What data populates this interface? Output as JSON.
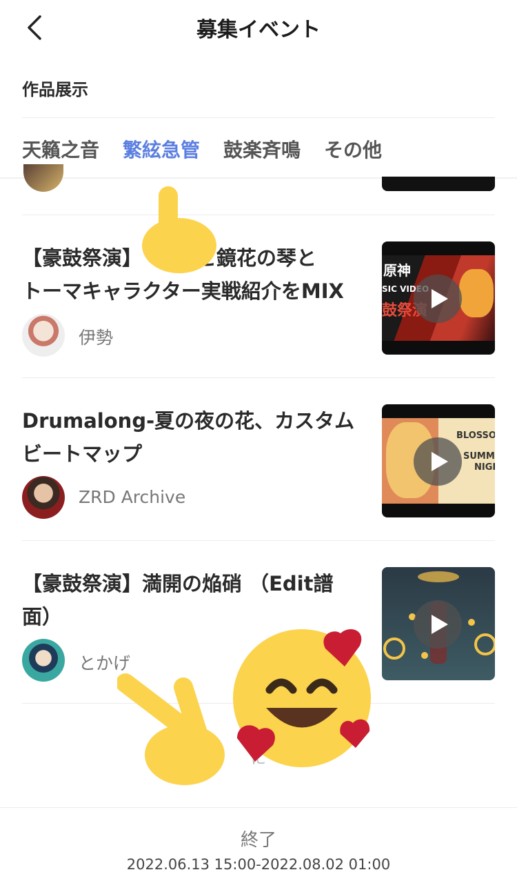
{
  "header": {
    "title": "募集イベント"
  },
  "section": {
    "label": "作品展示"
  },
  "tabs": [
    {
      "label": "天籟之音",
      "active": false
    },
    {
      "label": "繁絃急管",
      "active": true
    },
    {
      "label": "鼓楽斉鳴",
      "active": false
    },
    {
      "label": "その他",
      "active": false
    }
  ],
  "accent_color": "#5b7fe0",
  "posts": [
    {
      "title_line1": "【豪鼓祭演】",
      "title_line1_tail": "面と鏡花の琴と",
      "title_line2": "トーマキャラクター実戦紹介をMIX",
      "author": "伊勢"
    },
    {
      "title_line1": "Drumalong-夏の夜の花、カスタム",
      "title_line2": "ビートマップ",
      "author": "ZRD Archive"
    },
    {
      "title_line1": "【豪鼓祭演】満開の焔硝 （Edit譜",
      "title_line2": "面）",
      "author": "とかげ"
    }
  ],
  "thumbnails": [
    {
      "text_a": "原神",
      "text_b": "SIC VIDEO",
      "text_c": "鼓祭演"
    },
    {
      "text_a": "BLOSSO",
      "text_b": "SUMME",
      "text_c": "NIGH"
    },
    {}
  ],
  "list_end_partial": "に",
  "footer": {
    "status": "終了",
    "dates": "2022.06.13 15:00-2022.08.02 01:00"
  }
}
